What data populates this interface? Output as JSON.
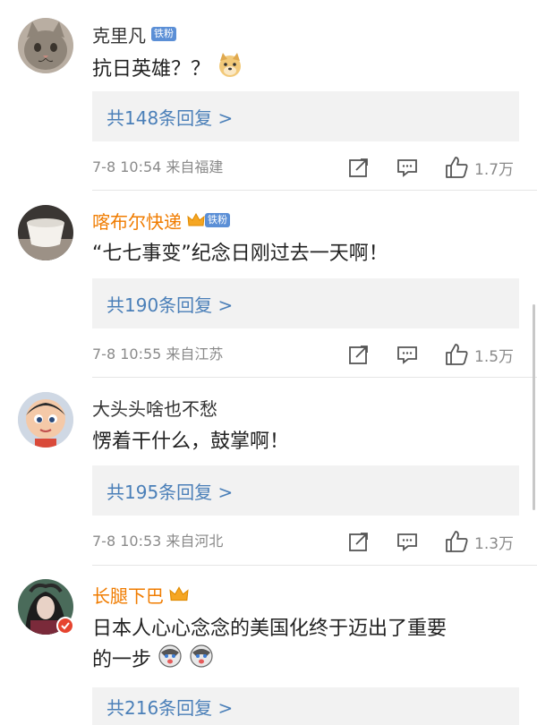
{
  "comments": [
    {
      "username": "克里凡",
      "badge": "铁粉",
      "text": "抗日英雄？？",
      "replies": "共148条回复 >",
      "meta": "7-8 10:54 来自福建",
      "likes": "1.7万"
    },
    {
      "username": "喀布尔快递",
      "badge": "铁粉",
      "text": "“七七事变”纪念日刚过去一天啊！",
      "replies": "共190条回复 >",
      "meta": "7-8 10:55 来自江苏",
      "likes": "1.5万"
    },
    {
      "username": "大头头啥也不愁",
      "text": "愣着干什么，鼓掌啊！",
      "replies": "共195条回复 >",
      "meta": "7-8 10:53 来自河北",
      "likes": "1.3万"
    },
    {
      "username": "长腿下巴",
      "text_line1": "日本人心心念念的美国化终于迈出了重要",
      "text_line2": "的一步",
      "replies": "共216条回复 >"
    }
  ],
  "icons": {
    "share": "share-icon",
    "comment": "comment-icon",
    "like": "thumbs-up-icon",
    "emoji_doge": "doge-emoji-icon",
    "emoji_husky": "husky-emoji-icon",
    "crown": "crown-icon",
    "verified": "verified-badge-icon"
  },
  "colors": {
    "vip_name": "#f07c00",
    "link": "#4a7fb8",
    "fan_badge": "#5b8fd6",
    "reply_bg": "#f2f2f2"
  }
}
